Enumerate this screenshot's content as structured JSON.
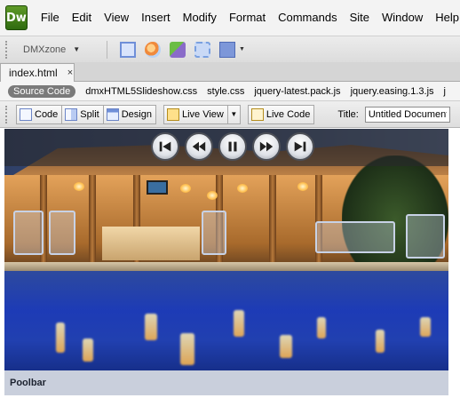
{
  "app": {
    "logo_text": "Dw"
  },
  "menu": [
    "File",
    "Edit",
    "View",
    "Insert",
    "Modify",
    "Format",
    "Commands",
    "Site",
    "Window",
    "Help"
  ],
  "insert_bar": {
    "category": "DMXzone"
  },
  "document_tab": {
    "name": "index.html",
    "close": "×"
  },
  "related_files": {
    "source_label": "Source Code",
    "files": [
      "dmxHTML5Slideshow.css",
      "style.css",
      "jquery-latest.pack.js",
      "jquery.easing.1.3.js",
      "j"
    ]
  },
  "doc_toolbar": {
    "code_label": "Code",
    "split_label": "Split",
    "design_label": "Design",
    "live_view_label": "Live View",
    "live_code_label": "Live Code",
    "title_label": "Title:",
    "title_value": "Untitled Document"
  },
  "slideshow": {
    "controls": [
      "first",
      "previous",
      "pause",
      "next",
      "last"
    ],
    "caption": "Poolbar"
  }
}
